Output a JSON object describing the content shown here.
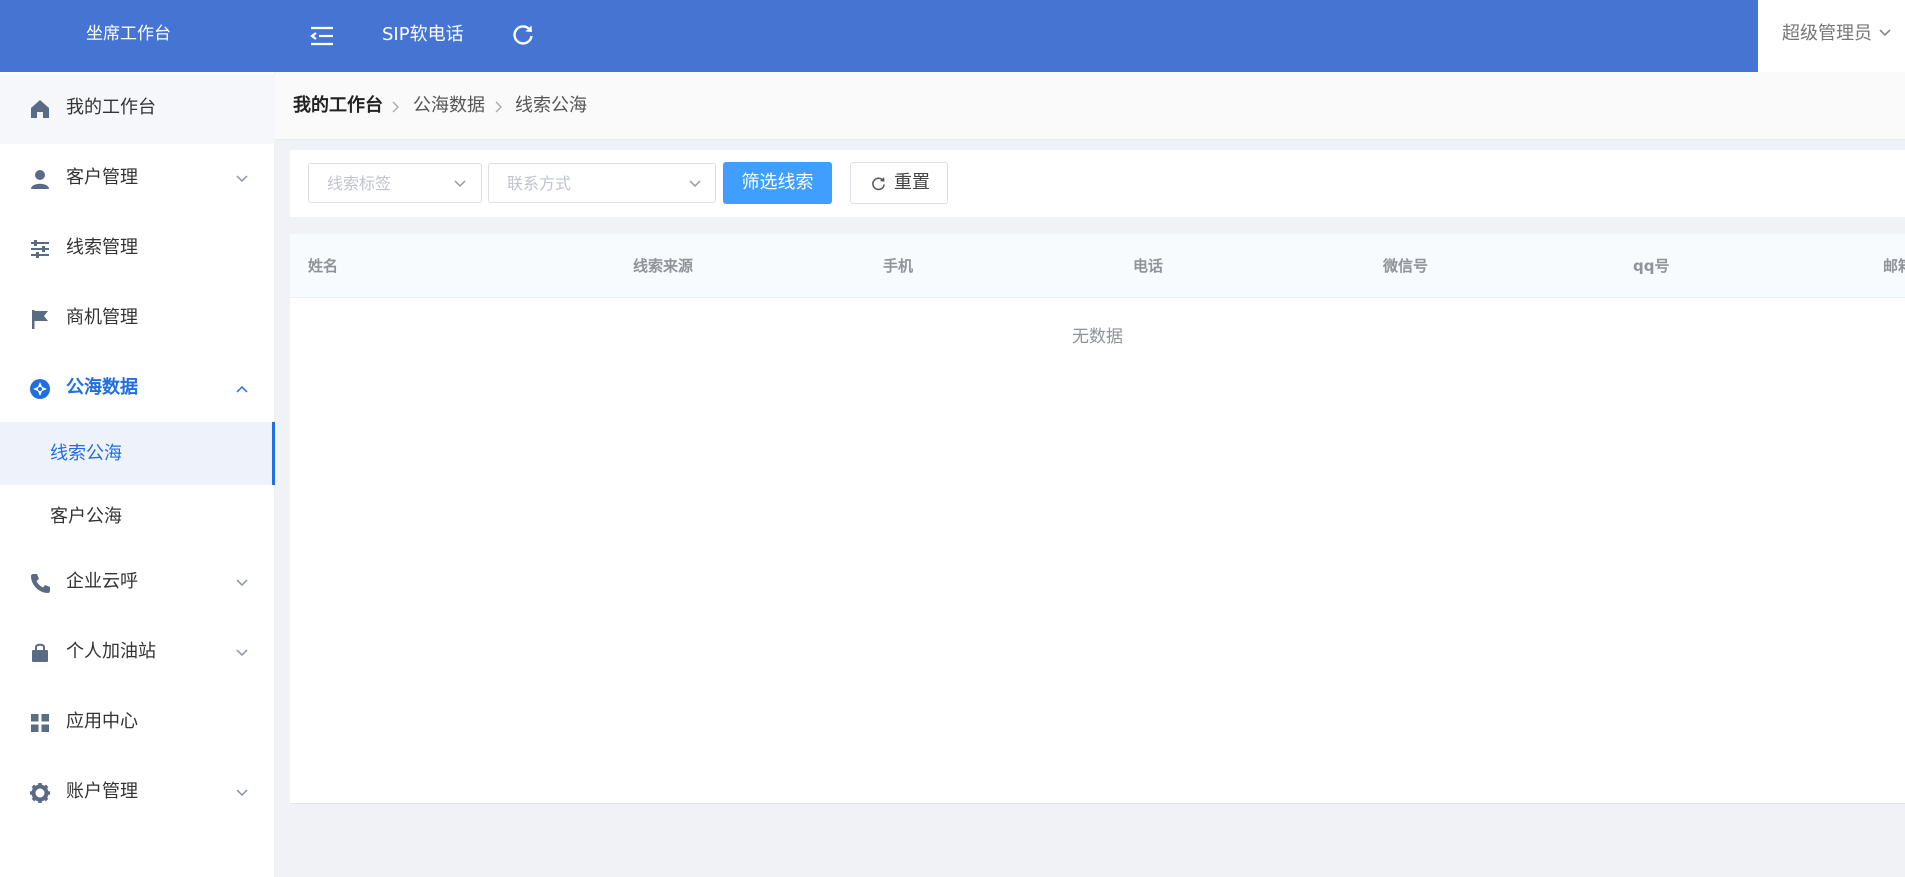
{
  "header": {
    "brand": "坐席工作台",
    "sip_label": "SIP软电话",
    "user_name": "超级管理员",
    "icons": {
      "menu": "menu-fold-icon",
      "refresh": "refresh-icon",
      "user_caret": "chevron-down-icon"
    },
    "bg_color": "#4574d3"
  },
  "sidebar": {
    "items": [
      {
        "label": "我的工作台",
        "icon": "home-icon"
      },
      {
        "label": "客户管理",
        "icon": "user-icon",
        "expandable": true
      },
      {
        "label": "线索管理",
        "icon": "sliders-icon"
      },
      {
        "label": "商机管理",
        "icon": "flag-icon"
      },
      {
        "label": "公海数据",
        "icon": "compass-icon",
        "expandable": true,
        "expanded": true,
        "active": true
      },
      {
        "label": "企业云呼",
        "icon": "phone-icon",
        "expandable": true
      },
      {
        "label": "个人加油站",
        "icon": "bag-icon",
        "expandable": true
      },
      {
        "label": "应用中心",
        "icon": "grid-icon"
      },
      {
        "label": "账户管理",
        "icon": "gear-icon",
        "expandable": true
      }
    ],
    "sub_items": [
      {
        "label": "线索公海",
        "selected": true
      },
      {
        "label": "客户公海",
        "selected": false
      }
    ],
    "active_color": "#1f6fe0"
  },
  "breadcrumb": [
    "我的工作台",
    "公海数据",
    "线索公海"
  ],
  "filters": {
    "tag_placeholder": "线索标签",
    "contact_placeholder": "联系方式",
    "filter_button": "筛选线索",
    "reset_button": "重置",
    "primary_color": "#409eff"
  },
  "table": {
    "columns": [
      "姓名",
      "线索来源",
      "手机",
      "电话",
      "微信号",
      "qq号",
      "邮箱"
    ],
    "empty_text": "无数据"
  }
}
